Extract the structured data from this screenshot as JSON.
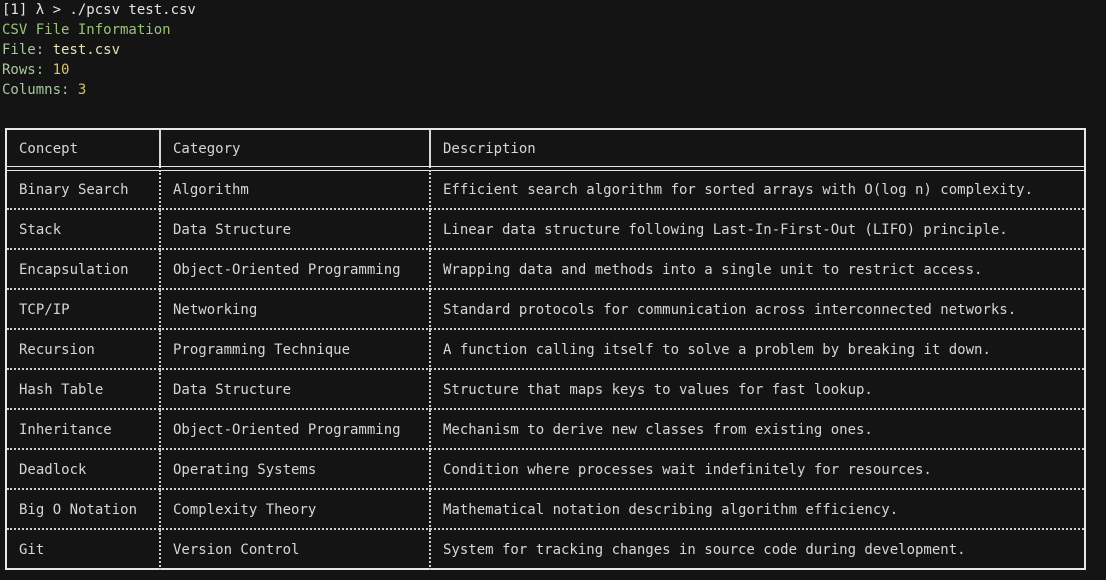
{
  "terminal": {
    "prompt": "[1] λ > ./pcsv test.csv",
    "info_title": "CSV File Information",
    "file_label": "File: ",
    "file_value": "test.csv",
    "rows_label": "Rows: ",
    "rows_value": "10",
    "columns_label": "Columns: ",
    "columns_value": "3"
  },
  "table": {
    "headers": [
      "Concept",
      "Category",
      "Description"
    ],
    "rows": [
      [
        "Binary Search",
        "Algorithm",
        "Efficient search algorithm for sorted arrays with O(log n) complexity."
      ],
      [
        "Stack",
        "Data Structure",
        "Linear data structure following Last-In-First-Out (LIFO) principle."
      ],
      [
        "Encapsulation",
        "Object-Oriented Programming",
        "Wrapping data and methods into a single unit to restrict access."
      ],
      [
        "TCP/IP",
        "Networking",
        "Standard protocols for communication across interconnected networks."
      ],
      [
        "Recursion",
        "Programming Technique",
        "A function calling itself to solve a problem by breaking it down."
      ],
      [
        "Hash Table",
        "Data Structure",
        "Structure that maps keys to values for fast lookup."
      ],
      [
        "Inheritance",
        "Object-Oriented Programming",
        "Mechanism to derive new classes from existing ones."
      ],
      [
        "Deadlock",
        "Operating Systems",
        "Condition where processes wait indefinitely for resources."
      ],
      [
        "Big O Notation",
        "Complexity Theory",
        "Mathematical notation describing algorithm efficiency."
      ],
      [
        "Git",
        "Version Control",
        "System for tracking changes in source code during development."
      ]
    ]
  }
}
